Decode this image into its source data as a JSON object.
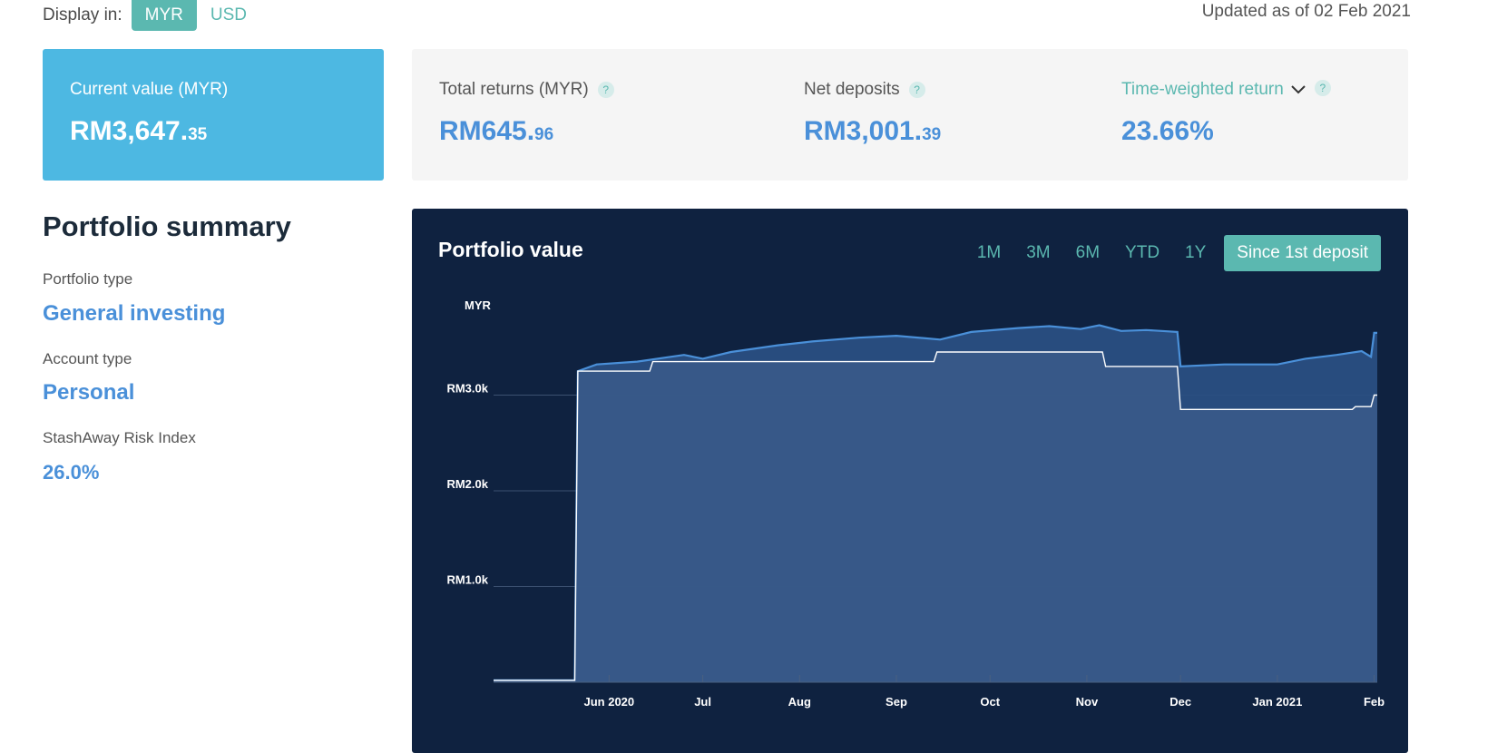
{
  "display": {
    "label": "Display in:",
    "currencies": [
      "MYR",
      "USD"
    ],
    "selected": "MYR",
    "updated": "Updated as of 02 Feb 2021"
  },
  "current_value": {
    "label": "Current value (MYR)",
    "main": "RM3,647.",
    "cents": "35"
  },
  "metrics": {
    "total_returns": {
      "label": "Total returns (MYR)",
      "main": "RM645.",
      "cents": "96"
    },
    "net_deposits": {
      "label": "Net deposits",
      "main": "RM3,001.",
      "cents": "39"
    },
    "twr": {
      "label": "Time-weighted return",
      "value": "23.66%"
    },
    "help_glyph": "?"
  },
  "summary": {
    "title": "Portfolio summary",
    "portfolio_type_label": "Portfolio type",
    "portfolio_type": "General investing",
    "account_type_label": "Account type",
    "account_type": "Personal",
    "risk_label": "StashAway Risk Index",
    "risk": "26.0%"
  },
  "chart": {
    "title": "Portfolio value",
    "ranges": [
      "1M",
      "3M",
      "6M",
      "YTD",
      "1Y",
      "Since 1st deposit"
    ],
    "selected_range": "Since 1st deposit"
  },
  "colors": {
    "teal": "#5bb8b0",
    "blue_card": "#4db8e2",
    "value_blue": "#4a90d9",
    "chart_bg": "#0f2240"
  },
  "chart_data": {
    "type": "area",
    "ylabel": "MYR",
    "yticks": [
      "RM1.0k",
      "RM2.0k",
      "RM3.0k"
    ],
    "ytick_values": [
      1000,
      2000,
      3000
    ],
    "ylim": [
      0,
      4000
    ],
    "xticks": [
      "Jun 2020",
      "Jul",
      "Aug",
      "Sep",
      "Oct",
      "Nov",
      "Dec",
      "Jan 2021",
      "Feb"
    ],
    "xtick_dates": [
      "2020-06-01",
      "2020-07-01",
      "2020-08-01",
      "2020-09-01",
      "2020-10-01",
      "2020-11-01",
      "2020-12-01",
      "2021-01-01",
      "2021-02-01"
    ],
    "xlim": [
      "2020-04-25",
      "2021-02-02"
    ],
    "series": [
      {
        "name": "",
        "color": "#4a90d9",
        "points": [
          [
            "2020-04-25",
            20
          ],
          [
            "2020-05-21",
            20
          ],
          [
            "2020-05-22",
            3250
          ],
          [
            "2020-05-28",
            3320
          ],
          [
            "2020-06-10",
            3350
          ],
          [
            "2020-06-25",
            3420
          ],
          [
            "2020-07-01",
            3380
          ],
          [
            "2020-07-10",
            3450
          ],
          [
            "2020-07-25",
            3520
          ],
          [
            "2020-08-05",
            3560
          ],
          [
            "2020-08-20",
            3600
          ],
          [
            "2020-09-01",
            3620
          ],
          [
            "2020-09-15",
            3580
          ],
          [
            "2020-09-25",
            3660
          ],
          [
            "2020-10-10",
            3700
          ],
          [
            "2020-10-20",
            3720
          ],
          [
            "2020-10-30",
            3690
          ],
          [
            "2020-11-05",
            3730
          ],
          [
            "2020-11-12",
            3670
          ],
          [
            "2020-11-20",
            3680
          ],
          [
            "2020-11-30",
            3660
          ],
          [
            "2020-12-01",
            3300
          ],
          [
            "2020-12-15",
            3320
          ],
          [
            "2021-01-01",
            3320
          ],
          [
            "2021-01-10",
            3380
          ],
          [
            "2021-01-20",
            3420
          ],
          [
            "2021-01-28",
            3460
          ],
          [
            "2021-01-31",
            3400
          ],
          [
            "2021-02-01",
            3650
          ],
          [
            "2021-02-02",
            3650
          ]
        ]
      },
      {
        "name": "",
        "color": "#ffffff",
        "points": [
          [
            "2020-04-25",
            20
          ],
          [
            "2020-05-21",
            20
          ],
          [
            "2020-05-22",
            3250
          ],
          [
            "2020-06-14",
            3250
          ],
          [
            "2020-06-15",
            3350
          ],
          [
            "2020-09-13",
            3350
          ],
          [
            "2020-09-14",
            3450
          ],
          [
            "2020-11-06",
            3450
          ],
          [
            "2020-11-07",
            3300
          ],
          [
            "2020-11-30",
            3300
          ],
          [
            "2020-12-01",
            2850
          ],
          [
            "2021-01-25",
            2850
          ],
          [
            "2021-01-26",
            2880
          ],
          [
            "2021-01-31",
            2880
          ],
          [
            "2021-02-01",
            3000
          ],
          [
            "2021-02-02",
            3000
          ]
        ]
      }
    ],
    "grid": true
  }
}
